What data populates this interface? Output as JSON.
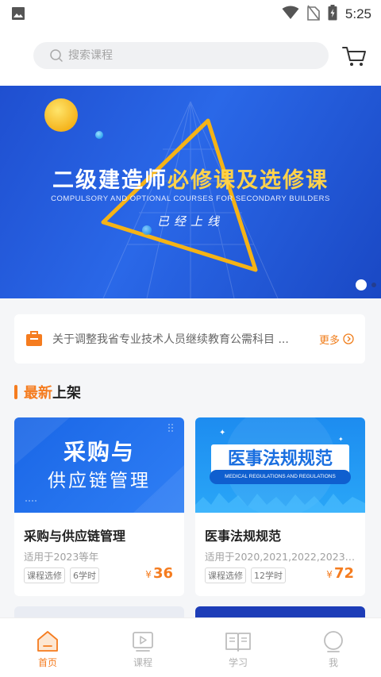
{
  "status_bar": {
    "time": "5:25"
  },
  "search": {
    "placeholder": "搜索课程"
  },
  "banner": {
    "title_white": "二级建造师",
    "title_highlight": "必修课及选修课",
    "subtitle": "COMPULSORY AND OPTIONAL COURSES FOR SECONDARY BUILDERS",
    "online": "已经上线"
  },
  "notice": {
    "text": "关于调整我省专业技术人员继续教育公需科目 ...",
    "more": "更多"
  },
  "section": {
    "title_highlight": "最新",
    "title_rest": "上架"
  },
  "courses": [
    {
      "thumb_line1": "采购与",
      "thumb_line2": "供应链管理",
      "title": "采购与供应链管理",
      "meta": "适用于2023等年",
      "tags": [
        "课程选修",
        "6学时"
      ],
      "price_symbol": "¥",
      "price": "36"
    },
    {
      "thumb_line1": "医事法规规范",
      "thumb_line2": "MEDICAL REGULATIONS AND REGULATIONS",
      "title": "医事法规规范",
      "meta": "适用于2020,2021,2022,2023,20...",
      "tags": [
        "课程选修",
        "12学时"
      ],
      "price_symbol": "¥",
      "price": "72"
    }
  ],
  "bottom_nav": [
    {
      "label": "首页",
      "icon": "home-icon",
      "active": true
    },
    {
      "label": "课程",
      "icon": "video-play-icon",
      "active": false
    },
    {
      "label": "学习",
      "icon": "book-icon",
      "active": false
    },
    {
      "label": "我",
      "icon": "user-icon",
      "active": false
    }
  ],
  "colors": {
    "accent": "#f57c1f",
    "banner_blue": "#2a68e8",
    "highlight_yellow": "#ffd24a"
  }
}
